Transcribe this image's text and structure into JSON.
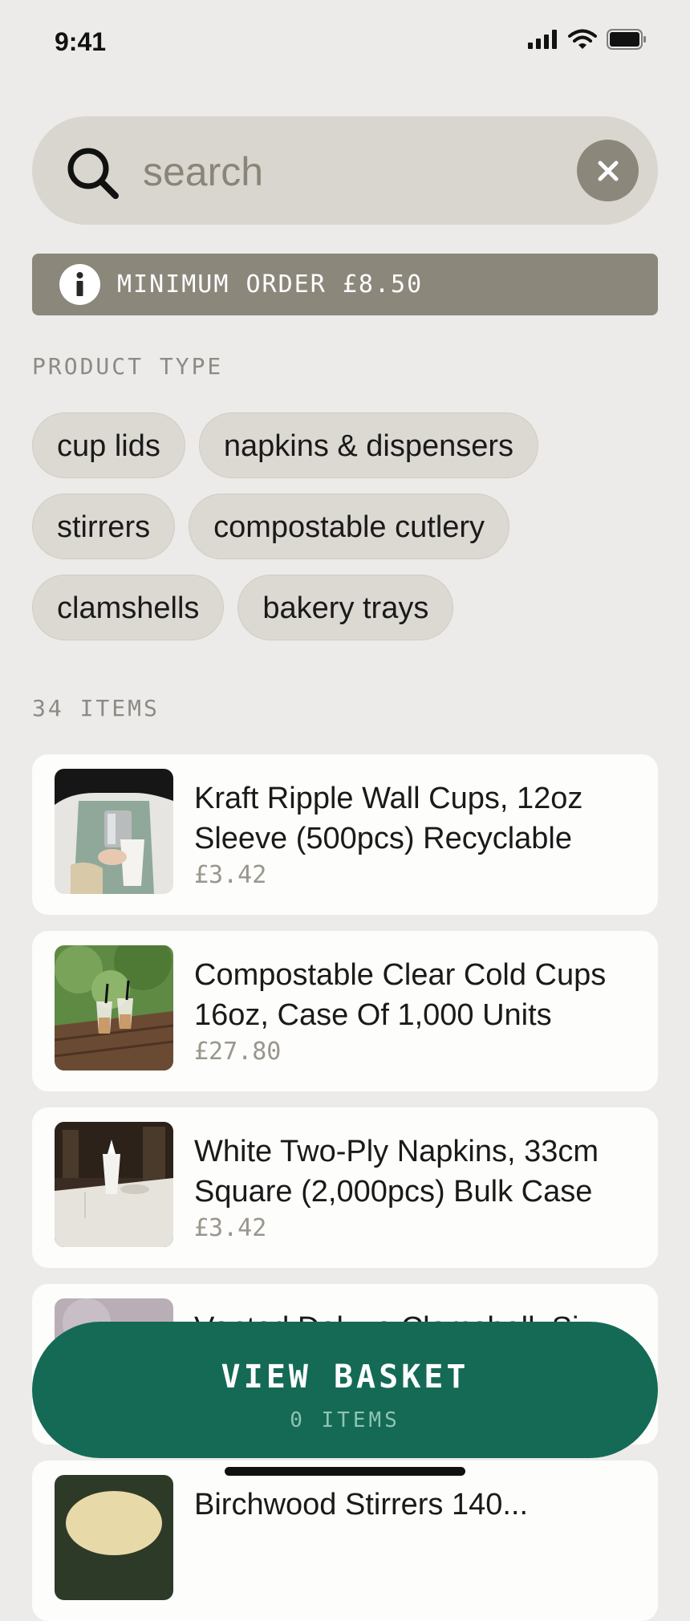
{
  "status_bar": {
    "time": "9:41"
  },
  "search": {
    "placeholder": "search",
    "value": ""
  },
  "notice": {
    "text": "MINIMUM ORDER £8.50"
  },
  "filters": {
    "label": "PRODUCT TYPE",
    "chips": [
      "cup lids",
      "napkins & dispensers",
      "stirrers",
      "compostable cutlery",
      "clamshells",
      "bakery trays"
    ]
  },
  "results": {
    "count_label": "34 ITEMS",
    "items": [
      {
        "name": "Kraft Ripple Wall Cups, 12oz Sleeve (500pcs) Recyclable",
        "price": "£3.42"
      },
      {
        "name": "Compostable Clear Cold Cups 16oz, Case Of 1,000 Units",
        "price": "£27.80"
      },
      {
        "name": "White Two-Ply Napkins, 33cm Square (2,000pcs) Bulk Case",
        "price": "£3.42"
      },
      {
        "name": "Vented Deluxe Clamshell, Si...",
        "price": ""
      },
      {
        "name": "Birchwood Stirrers 140...",
        "price": ""
      }
    ]
  },
  "basket": {
    "label": "VIEW BASKET",
    "count": "0 ITEMS"
  },
  "colors": {
    "accent": "#146a55",
    "background": "#ecebe9",
    "chip": "#dcd9d3",
    "notice": "#8c877b"
  }
}
